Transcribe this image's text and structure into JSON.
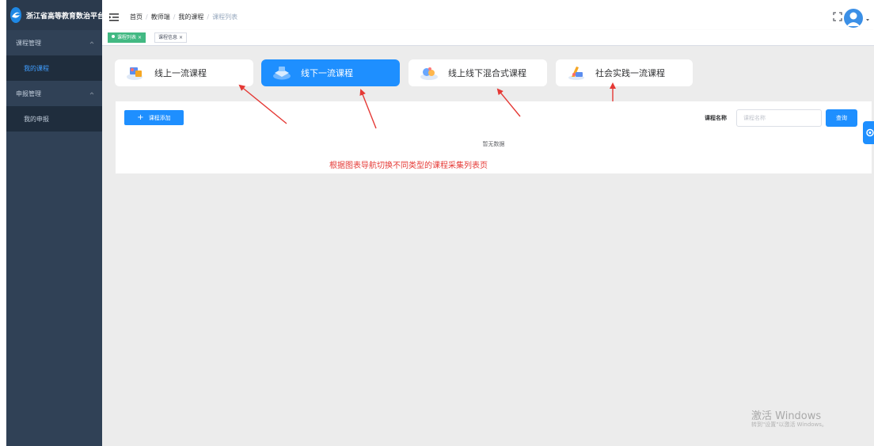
{
  "app": {
    "title": "浙江省高等教育数治平台"
  },
  "sidebar": {
    "groups": [
      {
        "label": "课程管理",
        "items": [
          {
            "label": "我的课程",
            "active": true
          }
        ]
      },
      {
        "label": "申报管理",
        "items": [
          {
            "label": "我的申报",
            "active": false
          }
        ]
      }
    ]
  },
  "breadcrumb": {
    "items": [
      "首页",
      "教师端",
      "我的课程",
      "课程列表"
    ],
    "separator": "/"
  },
  "tags": [
    {
      "label": "课程列表",
      "active": true,
      "close": "×"
    },
    {
      "label": "课程信息",
      "active": false,
      "close": "×"
    }
  ],
  "course_tabs": [
    {
      "label": "线上一流课程",
      "active": false,
      "icon": "online-course-icon"
    },
    {
      "label": "线下一流课程",
      "active": true,
      "icon": "offline-course-icon"
    },
    {
      "label": "线上线下混合式课程",
      "active": false,
      "icon": "hybrid-course-icon"
    },
    {
      "label": "社会实践一流课程",
      "active": false,
      "icon": "social-practice-icon"
    }
  ],
  "toolbar": {
    "add_icon": "+",
    "add_label": "课程添加",
    "search_label": "课程名称",
    "search_placeholder": "课程名称",
    "search_value": "",
    "query_label": "查询"
  },
  "table": {
    "empty_text": "暂无数据"
  },
  "annotation": "根据图表导航切换不同类型的课程采集列表页",
  "watermark": {
    "line1": "激活 Windows",
    "line2": "转到\"设置\"以激活 Windows。"
  },
  "colors": {
    "sidebar_bg": "#304156",
    "primary": "#1e8fff",
    "tag_active": "#42b983",
    "annotation": "#e53935"
  }
}
